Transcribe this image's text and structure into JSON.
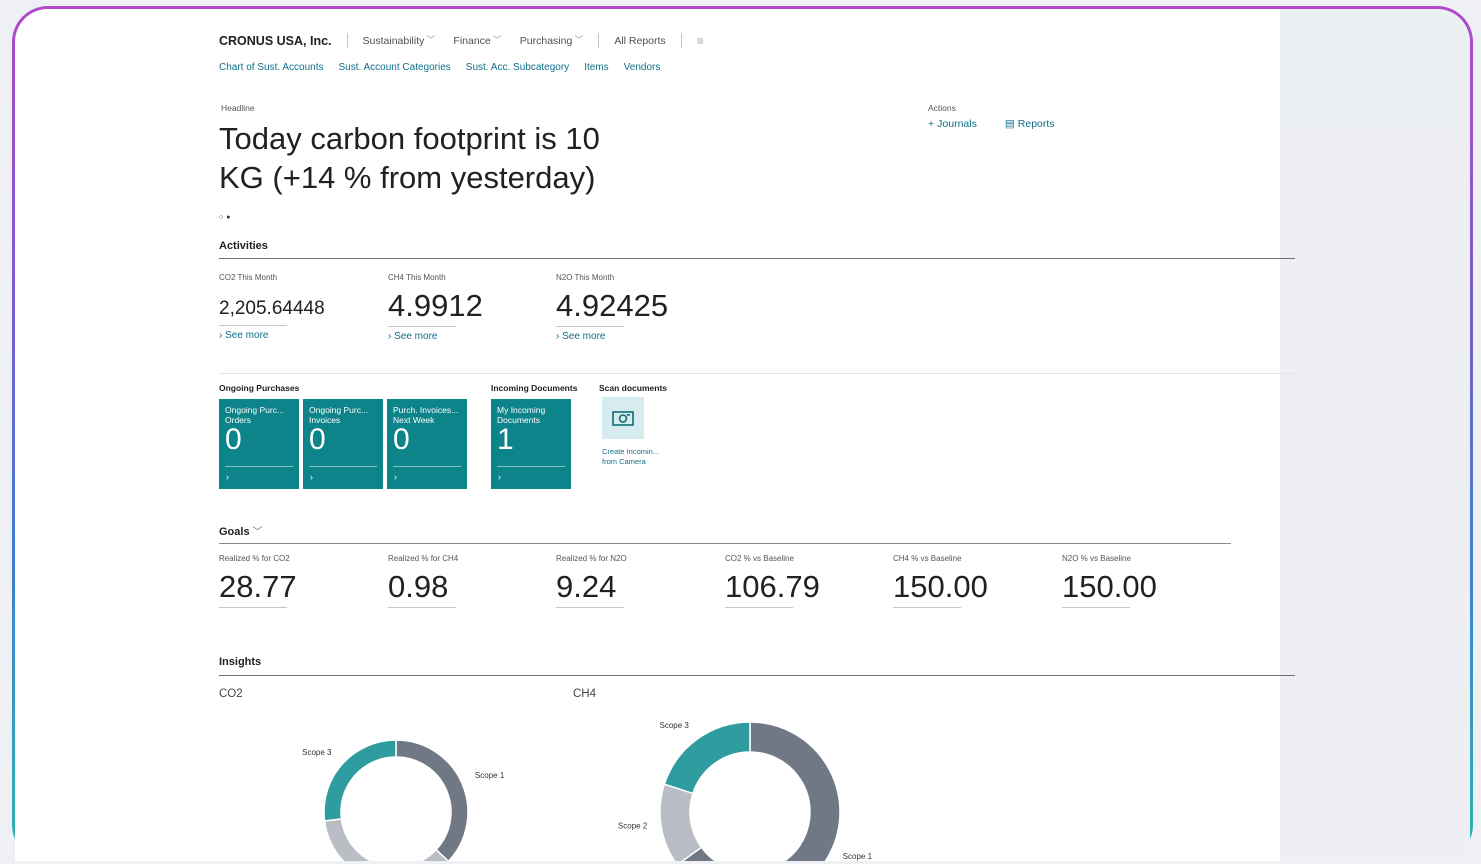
{
  "nav": {
    "brand": "CRONUS USA, Inc.",
    "menus": [
      "Sustainability",
      "Finance",
      "Purchasing"
    ],
    "all_reports": "All Reports",
    "links": [
      "Chart of Sust. Accounts",
      "Sust. Account Categories",
      "Sust. Acc. Subcategory",
      "Items",
      "Vendors"
    ]
  },
  "headline": {
    "caption": "Headline",
    "text": "Today carbon footprint is 10 KG (+14 % from yesterday)"
  },
  "actions": {
    "caption": "Actions",
    "journals": "Journals",
    "reports": "Reports"
  },
  "activities": {
    "title": "Activities",
    "tiles": [
      {
        "caption": "CO2 This Month",
        "value": "2,205.64448",
        "link": "See more"
      },
      {
        "caption": "CH4 This Month",
        "value": "4.9912",
        "link": "See more"
      },
      {
        "caption": "N2O This Month",
        "value": "4.92425",
        "link": "See more"
      }
    ]
  },
  "cues": {
    "ongoing_title": "Ongoing Purchases",
    "incoming_title": "Incoming Documents",
    "scan_title": "Scan documents",
    "items": [
      {
        "title": "Ongoing Purc... Orders",
        "value": "0"
      },
      {
        "title": "Ongoing Purc... Invoices",
        "value": "0"
      },
      {
        "title": "Purch. Invoices... Next Week",
        "value": "0"
      },
      {
        "title": "My Incoming Documents",
        "value": "1"
      }
    ],
    "scan_label_1": "Create Incomin...",
    "scan_label_2": "from Camera"
  },
  "goals": {
    "title": "Goals",
    "tiles": [
      {
        "caption": "Realized % for CO2",
        "value": "28.77"
      },
      {
        "caption": "Realized % for CH4",
        "value": "0.98"
      },
      {
        "caption": "Realized % for N2O",
        "value": "9.24"
      },
      {
        "caption": "CO2 % vs Baseline",
        "value": "106.79"
      },
      {
        "caption": "CH4 % vs Baseline",
        "value": "150.00"
      },
      {
        "caption": "N2O % vs Baseline",
        "value": "150.00"
      }
    ]
  },
  "insights": {
    "title": "Insights",
    "co2_label": "CO2",
    "ch4_label": "CH4"
  },
  "chart_data": [
    {
      "type": "pie",
      "title": "CO2",
      "categories": [
        "Scope 1",
        "Scope 2",
        "Scope 3"
      ],
      "values": [
        37,
        36,
        27
      ],
      "colors": [
        "#6f7884",
        "#b9bdc4",
        "#2f9ca0"
      ]
    },
    {
      "type": "pie",
      "title": "CH4",
      "categories": [
        "Scope 1",
        "Scope 2",
        "Scope 3"
      ],
      "values": [
        65,
        15,
        20
      ],
      "colors": [
        "#6f7884",
        "#b9bdc4",
        "#2f9ca0"
      ]
    }
  ]
}
